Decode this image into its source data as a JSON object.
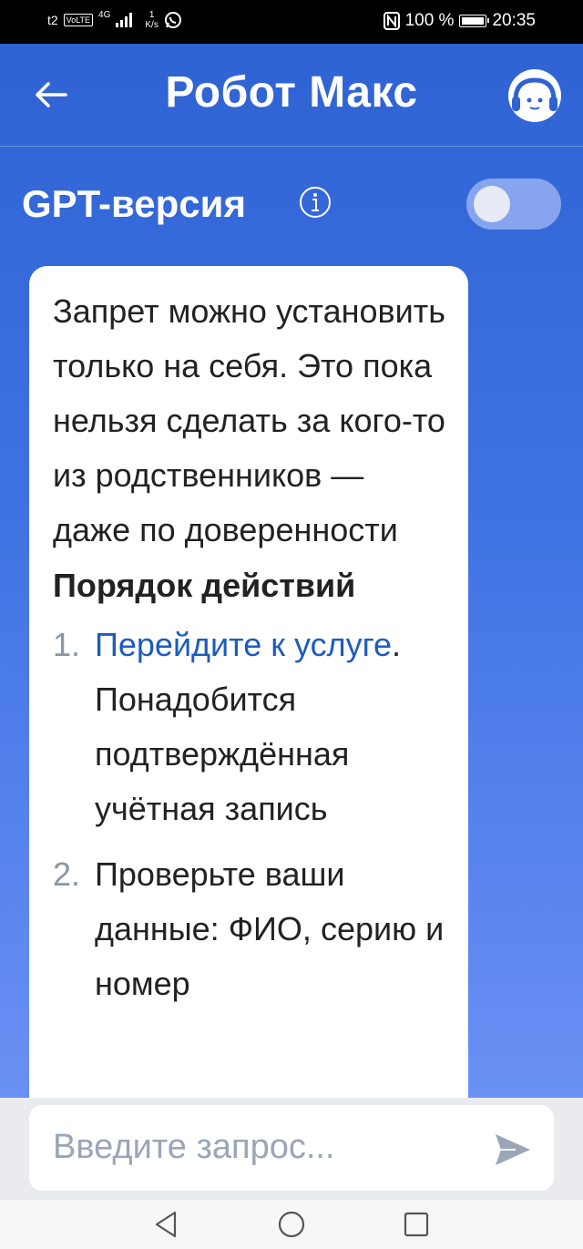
{
  "status_bar": {
    "carrier": "t2",
    "volte": "VoLTE",
    "network": "4G",
    "speed_value": "1",
    "speed_unit": "K/s",
    "battery_text": "100 %",
    "time": "20:35"
  },
  "header": {
    "title": "Робот Макс"
  },
  "gpt": {
    "label": "GPT-версия",
    "enabled": false
  },
  "message": {
    "intro": "Запрет можно установить только на себя. Это пока нельзя сделать за кого-то из родственников — даже по доверенности",
    "steps_title": "Порядок действий",
    "steps": [
      {
        "num": "1.",
        "link": "Перейдите к услуге",
        "after_link": ".",
        "text": "Понадобится подтверждённая учётная запись"
      },
      {
        "num": "2.",
        "text": "Проверьте ваши данные: ФИО, серию и номер"
      }
    ]
  },
  "input": {
    "placeholder": "Введите запрос..."
  },
  "colors": {
    "primary": "#2f63d3",
    "link": "#1d5bbf"
  }
}
